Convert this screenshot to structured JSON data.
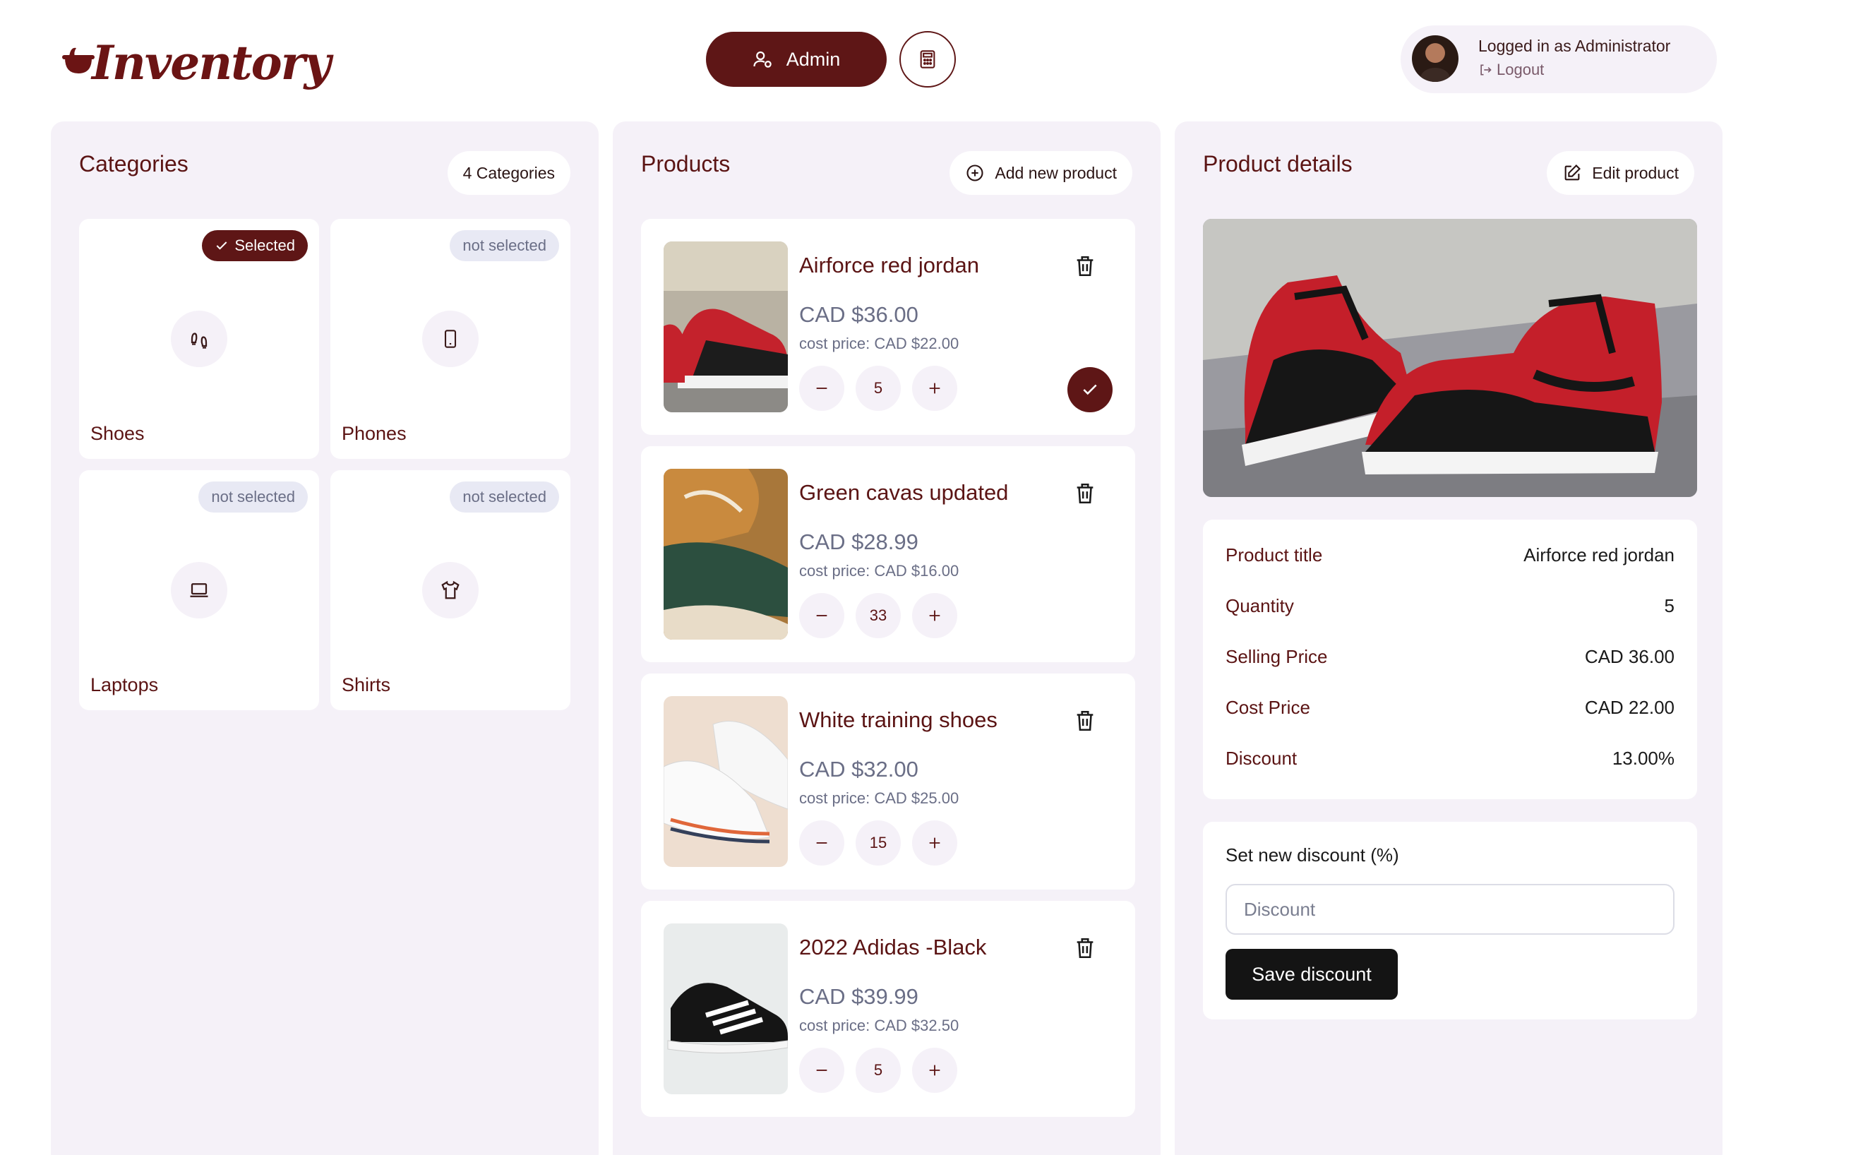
{
  "header": {
    "logo_text": "Inventory",
    "admin_label": "Admin",
    "user_status": "Logged in as Administrator",
    "logout_label": "Logout"
  },
  "categories_panel": {
    "title": "Categories",
    "count_label": "4 Categories",
    "items": [
      {
        "name": "Shoes",
        "status": "Selected",
        "selected": true,
        "icon": "footprints-icon"
      },
      {
        "name": "Phones",
        "status": "not selected",
        "selected": false,
        "icon": "phone-icon"
      },
      {
        "name": "Laptops",
        "status": "not selected",
        "selected": false,
        "icon": "laptop-icon"
      },
      {
        "name": "Shirts",
        "status": "not selected",
        "selected": false,
        "icon": "shirt-icon"
      }
    ]
  },
  "products_panel": {
    "title": "Products",
    "add_label": "Add new product",
    "items": [
      {
        "title": "Airforce red jordan",
        "price": "CAD $36.00",
        "cost": "cost price: CAD $22.00",
        "quantity": "5",
        "selected": true
      },
      {
        "title": "Green cavas updated",
        "price": "CAD $28.99",
        "cost": "cost price: CAD $16.00",
        "quantity": "33",
        "selected": false
      },
      {
        "title": "White training shoes",
        "price": "CAD $32.00",
        "cost": "cost price: CAD $25.00",
        "quantity": "15",
        "selected": false
      },
      {
        "title": "2022 Adidas -Black",
        "price": "CAD $39.99",
        "cost": "cost price: CAD $32.50",
        "quantity": "5",
        "selected": false
      }
    ]
  },
  "details_panel": {
    "title": "Product details",
    "edit_label": "Edit product",
    "rows": [
      {
        "key": "Product title",
        "value": "Airforce red jordan"
      },
      {
        "key": "Quantity",
        "value": "5"
      },
      {
        "key": "Selling Price",
        "value": "CAD 36.00"
      },
      {
        "key": "Cost Price",
        "value": "CAD 22.00"
      },
      {
        "key": "Discount",
        "value": "13.00%"
      }
    ],
    "discount_form": {
      "label": "Set new discount (%)",
      "placeholder": "Discount",
      "value": "",
      "save_label": "Save discount"
    }
  },
  "colors": {
    "brand": "#5e1616",
    "panel_bg": "#f5f1f8",
    "muted_text": "#6a6e86",
    "badge_off_bg": "#e8e9f4"
  }
}
